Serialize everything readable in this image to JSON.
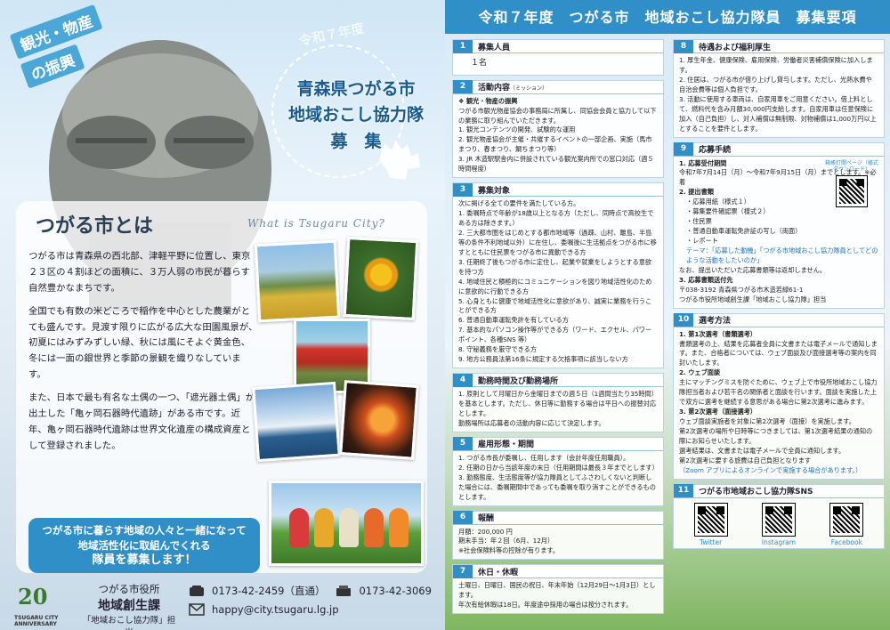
{
  "left": {
    "tag_line1": "観光・物産",
    "tag_line2": "の振興",
    "title_year": "令和７年度",
    "title_line1": "青森県つがる市",
    "title_line2": "地域おこし協力隊",
    "title_line3": "募　集",
    "card_title": "つがる市とは",
    "card_sub": "What is Tsugaru City?",
    "paragraphs": [
      "つがる市は青森県の西北部、津軽平野に位置し、東京２３区の４割ほどの面積に、３万人弱の市民が暮らす自然豊かなまちです。",
      "全国でも有数の米どころで稲作を中心とした農業がとても盛んです。見渡す限りに広がる広大な田園風景が、初夏にはみずみずしい緑、秋には風にそよぐ黄金色、冬には一面の銀世界と季節の景観を織りなしています。",
      "また、日本で最も有名な土偶の一つ、「遮光器土偶」が出土した「亀ヶ岡石器時代遺跡」がある市です。近年、亀ヶ岡石器時代遺跡は世界文化遺産の構成資産として登録されました。"
    ],
    "banner": [
      "つがる市に暮らす地域の人々と一緒になって",
      "地域活性化に取組んでくれる",
      "隊員を募集します！"
    ],
    "logo_num": "20",
    "logo_caption": "TSUGARU CITY ANNIVERSARY",
    "office_line1": "つがる市役所",
    "office_line2": "地域創生課",
    "office_line3": "「地域おこし協力隊」担当",
    "tel1": "0173-42-2459（直通）",
    "fax": "0173-42-3069",
    "email": "happy@city.tsugaru.lg.jp"
  },
  "right": {
    "header": "令和７年度　つがる市　地域おこし協力隊員　募集要項",
    "sections_a": [
      {
        "n": "1",
        "title": "募集人員",
        "lines": [
          "１名"
        ]
      },
      {
        "n": "2",
        "title": "活動内容",
        "title_note": "（ミッション）",
        "lines": [
          "❖ 観光・物産の振興",
          "つがる市観光物産協会の事務局に所属し、同協会会員と協力して以下の業務に取り組んでいただきます。",
          "1. 観光コンテンツの開発、試験的な運用",
          "2. 観光物産協会が主催・共催するイベントの一部企画、実施（馬市まつり、春まつり、鯛ちまつり等）",
          "3. JR 木造駅駅舎内に併設されている観光案内所での窓口対応（週５時間程度）"
        ]
      },
      {
        "n": "3",
        "title": "募集対象",
        "lines": [
          "次に掲げる全ての要件を満たしている方。",
          "1. 委嘱時点で年齢が18歳以上となる方（ただし、同時点で高校生である方は除きます。）",
          "2. 三大都市圏をはじめとする都市地域等（過疎、山村、離島、半島等の条件不利地域以外）に在住し、委嘱後に生活拠点をつがる市に移すとともに住民票をつがる市に異動できる方",
          "3. 任期終了後もつがる市に定住し、起業や就業をしようとする意欲を持つ方",
          "4. 地域住民と積極的にコミュニケーションを図り地域活性化のために意欲的に行動できる方",
          "5. 心身ともに健康で地域活性化に意欲があり、誠実に業務を行うことができる方",
          "6. 普通自動車運転免許を有している方",
          "7. 基本的なパソコン操作等ができる方（ワード、エクセル、パワーポイント、各種SNS 等）",
          "8. 守秘義務を厳守できる方",
          "9. 地方公務員法第16条に規定する欠格事項に該当しない方"
        ]
      },
      {
        "n": "4",
        "title": "勤務時間及び勤務場所",
        "lines": [
          "1. 原則として月曜日から金曜日までの週５日（1週間当たり35時間）を基本とします。ただし、休日等に勤務する場合は平日への振替対応とします。",
          "勤務場所は応募者の活動内容に応じて決定します。"
        ]
      },
      {
        "n": "5",
        "title": "雇用形態・期間",
        "lines": [
          "1. つがる市長が委嘱し、任用します（会計年度任用職員）。",
          "2. 任期の日から当該年度の末日（任用期間は最長３年までとします）",
          "3. 勤務態度、生活態度等が協力隊員としてふさわしくないと判断した場合には、委嘱期間中であっても委嘱を取り消すことができるものとします。"
        ]
      },
      {
        "n": "6",
        "title": "報酬",
        "lines": [
          "月額：200,000 円",
          "期末手当：年２回（6月、12月）",
          "※社会保険料等の控除が有ります。"
        ]
      },
      {
        "n": "7",
        "title": "休日・休暇",
        "lines": [
          "土曜日、日曜日、国民の祝日、年末年始（12月29日〜1月3日）とします。",
          "年次有給休暇は18日。年度途中採用の場合は按分されます。"
        ]
      }
    ],
    "sections_b": [
      {
        "n": "8",
        "title": "待遇および福利厚生",
        "lines": [
          "1. 厚生年金、健康保険、雇用保険、労働者災害補償保険に加入します。",
          "2. 住居は、つがる市が借り上げし貸与します。ただし、光熱水費や自治会費等は個人負担です。",
          "3. 活動に使用する車両は、自家用車をご用意ください。借上料として、燃料代を含み月額30,000円支給します。自家用車は任意保険に加入（自己負担）し、対人補償は無制限、対物補償は1,000万円以上とすることを要件とします。"
        ]
      },
      {
        "n": "9",
        "title": "応募手続",
        "lines": [
          "1. 応募受付期間",
          "令和7年7月14日（月）〜令和7年9月15日（月）までとします。※必着",
          "2. 提出書類",
          "・応募用紙（様式１）",
          "・募集要件確認票（様式２）",
          "・住民票",
          "・普通自動車運転免許証の写し（両面）",
          "・レポート",
          "テーマ：「応募した動機」「つがる市地域おこし協力隊員としてどのような活動をしたいのか」",
          "なお、提出いただいた応募書類等は返却しません。",
          "3. 応募書類送付先",
          "〒038-3192 青森県つがる市木造若緑61-1",
          "つがる市役所地域創生課「地域おこし協力隊」担当"
        ],
        "qr_caption": "箱帳打開ページ（様式ダウンロード）"
      },
      {
        "n": "10",
        "title": "選考方法",
        "lines": [
          "1. 第1次選考（書類選考）",
          "書類選考の上、結果を応募者全員に文書または電子メールで通知します。また、合格者については、ウェブ面談及び面接選考等の案内を同封いたします。",
          "2. ウェブ面談",
          "主にマッチングミスを防ぐために、ウェブ上で市役所地域おこし協力隊担当者および若干名の関係者と面談を行います。面談を実施した上で双方に選考を継続する意思がある場合に第2次選考に進みます。",
          "3. 第2次選考（面接選考）",
          "ウェブ面談実施者を対象に第2次選考（面接）を実施します。",
          "第2次選考の場所や日時等につきましては、第1次選考結果の通知の際にお知らせいたします。",
          "選考結果は、文書または電子メールで全員に通知します。",
          "第2次選考に要する旅費は自己負担となります",
          "（Zoom アプリによるオンラインで実施する場合があります。）"
        ]
      },
      {
        "n": "11",
        "title": "つがる市地域おこし協力隊SNS",
        "sns": [
          "Twitter",
          "Instagram",
          "Facebook"
        ]
      }
    ]
  }
}
